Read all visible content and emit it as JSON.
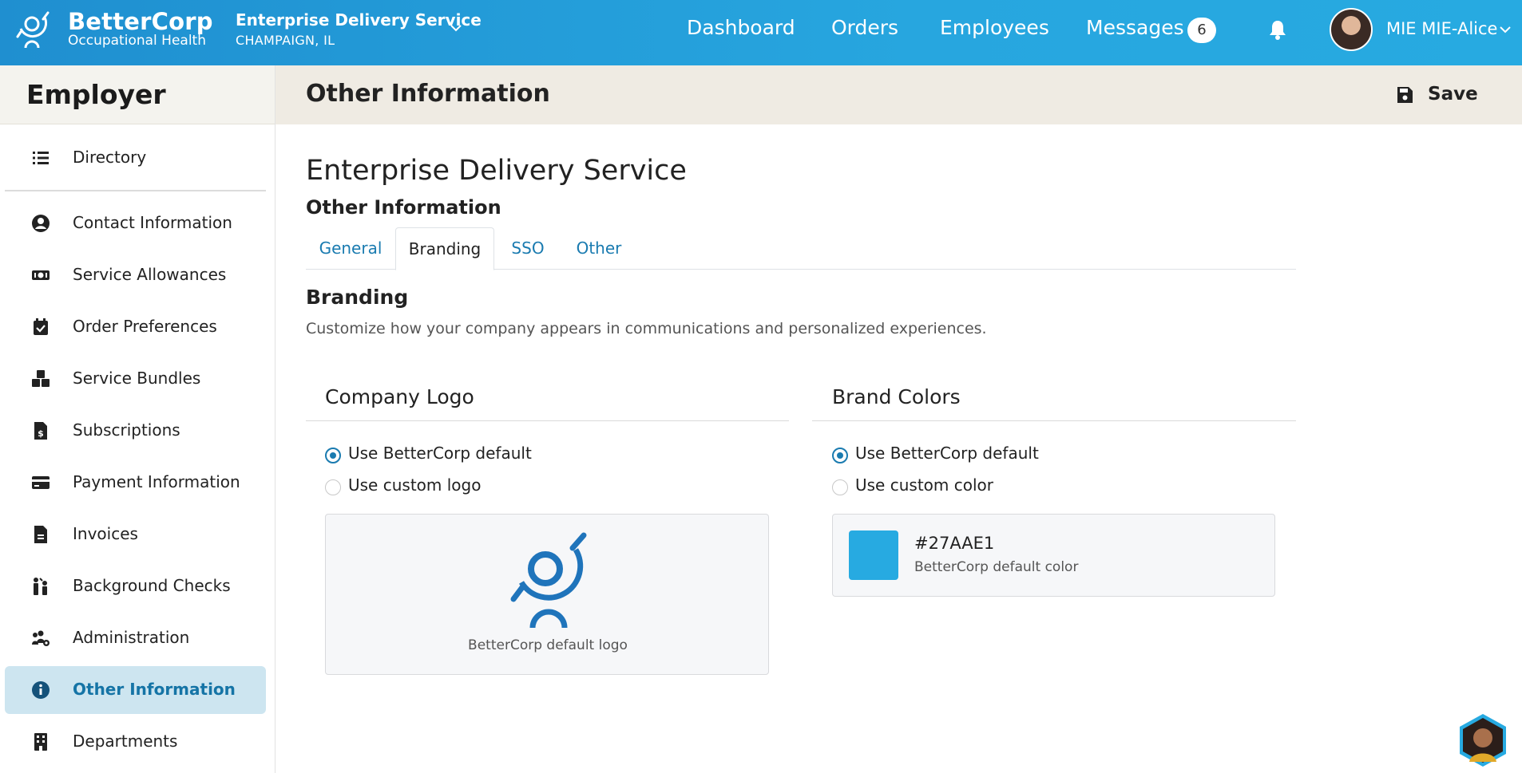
{
  "brand": {
    "name": "BetterCorp",
    "subtitle": "Occupational Health",
    "color": "#27AAE1"
  },
  "org": {
    "name": "Enterprise Delivery Service",
    "location": "CHAMPAIGN, IL"
  },
  "nav": {
    "dashboard": "Dashboard",
    "orders": "Orders",
    "employees": "Employees",
    "messages": "Messages",
    "messages_count": "6"
  },
  "user": {
    "name": "MIE MIE-Alice"
  },
  "sidebar": {
    "title": "Employer",
    "items": [
      {
        "label": "Directory",
        "icon": "list-icon"
      },
      {
        "label": "Contact Information",
        "icon": "user-circle-icon"
      },
      {
        "label": "Service Allowances",
        "icon": "money-icon"
      },
      {
        "label": "Order Preferences",
        "icon": "calendar-check-icon"
      },
      {
        "label": "Service Bundles",
        "icon": "cubes-icon"
      },
      {
        "label": "Subscriptions",
        "icon": "invoice-dollar-icon"
      },
      {
        "label": "Payment Information",
        "icon": "credit-card-icon"
      },
      {
        "label": "Invoices",
        "icon": "file-icon"
      },
      {
        "label": "Background Checks",
        "icon": "people-check-icon"
      },
      {
        "label": "Administration",
        "icon": "users-cog-icon"
      },
      {
        "label": "Other Information",
        "icon": "info-circle-icon",
        "active": true
      },
      {
        "label": "Departments",
        "icon": "building-icon"
      }
    ]
  },
  "page": {
    "title": "Other Information",
    "save_label": "Save"
  },
  "content": {
    "company": "Enterprise Delivery Service",
    "section_title": "Other Information",
    "tabs": [
      {
        "label": "General"
      },
      {
        "label": "Branding",
        "active": true
      },
      {
        "label": "SSO"
      },
      {
        "label": "Other"
      }
    ],
    "branding_title": "Branding",
    "branding_desc": "Customize how your company appears in communications and personalized experiences."
  },
  "logo_card": {
    "title": "Company Logo",
    "options": [
      {
        "label": "Use BetterCorp default",
        "checked": true
      },
      {
        "label": "Use custom logo",
        "checked": false
      }
    ],
    "preview_caption": "BetterCorp default logo"
  },
  "color_card": {
    "title": "Brand Colors",
    "options": [
      {
        "label": "Use BetterCorp default",
        "checked": true
      },
      {
        "label": "Use custom color",
        "checked": false
      }
    ],
    "hex": "#27AAE1",
    "caption": "BetterCorp default color"
  }
}
